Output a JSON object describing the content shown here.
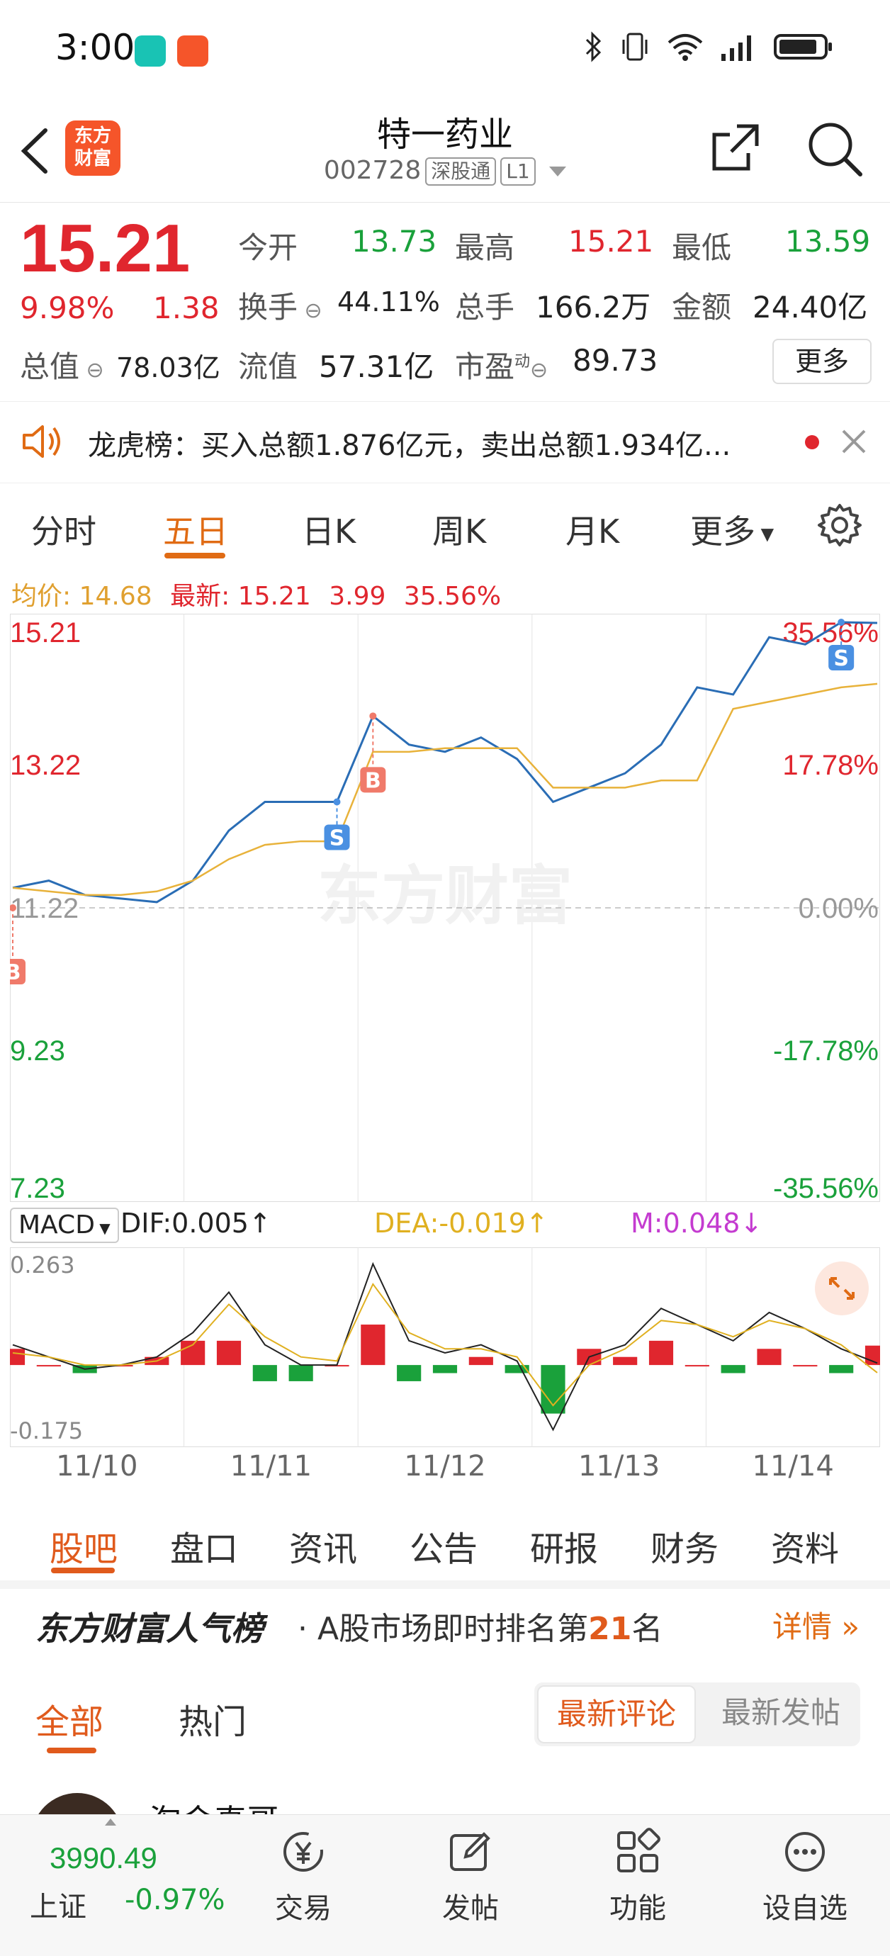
{
  "status_bar": {
    "time": "3:00"
  },
  "header": {
    "title": "特一药业",
    "code": "002728",
    "tag1": "深股通",
    "tag2": "L1",
    "logo_line1": "东方",
    "logo_line2": "财富"
  },
  "quote": {
    "price": "15.21",
    "change_pct": "9.98%",
    "change": "1.38",
    "open_label": "今开",
    "open": "13.73",
    "high_label": "最高",
    "high": "15.21",
    "low_label": "最低",
    "low": "13.59",
    "turnover_label": "换手",
    "turnover": "44.11%",
    "volume_label": "总手",
    "volume": "166.2万",
    "amount_label": "金额",
    "amount": "24.40亿",
    "mktcap_label": "总值",
    "mktcap": "78.03亿",
    "float_label": "流值",
    "float": "57.31亿",
    "pe_label": "市盈",
    "pe_sup": "动",
    "pe": "89.73",
    "more": "更多"
  },
  "notice": {
    "text": "龙虎榜：买入总额1.876亿元，卖出总额1.934亿..."
  },
  "chart_tabs": [
    "分时",
    "五日",
    "日K",
    "周K",
    "月K",
    "更多"
  ],
  "legend": {
    "avg_label": "均价:",
    "avg": "14.68",
    "latest_label": "最新:",
    "latest": "15.21",
    "chg": "3.99",
    "chg_pct": "35.56%"
  },
  "chart_data": {
    "type": "line",
    "x": [
      "11/10",
      "11/11",
      "11/12",
      "11/13",
      "11/14"
    ],
    "y_ticks": [
      "15.21",
      "13.22",
      "11.22",
      "9.23",
      "7.23"
    ],
    "y_ticks_pct": [
      "35.56%",
      "17.78%",
      "0.00%",
      "-17.78%",
      "-35.56%"
    ],
    "ylim": [
      7.23,
      15.21
    ],
    "base": 11.22,
    "series": [
      {
        "values": [
          11.5,
          11.6,
          11.4,
          11.35,
          11.3,
          11.6,
          12.3,
          12.7,
          12.7,
          12.7,
          13.9,
          13.5,
          13.4,
          13.6,
          13.3,
          12.7,
          12.9,
          13.1,
          13.5,
          14.3,
          14.2,
          15.0,
          14.9,
          15.21,
          15.2
        ]
      },
      {
        "values": [
          11.5,
          11.45,
          11.4,
          11.4,
          11.45,
          11.6,
          11.9,
          12.1,
          12.15,
          12.15,
          13.4,
          13.4,
          13.45,
          13.45,
          13.45,
          12.9,
          12.9,
          12.9,
          13.0,
          13.0,
          14.0,
          14.1,
          14.2,
          14.3,
          14.35
        ]
      }
    ],
    "markers": [
      {
        "label": "B",
        "x_index": 0,
        "value": 11.22
      },
      {
        "label": "S",
        "x_index": 9,
        "value": 12.7
      },
      {
        "label": "B",
        "x_index": 10,
        "value": 13.9
      },
      {
        "label": "S",
        "x_index": 23,
        "value": 15.21
      }
    ],
    "watermark": "东方财富",
    "macd": {
      "indicator": "MACD",
      "dif_label": "DIF:0.005↑",
      "dea_label": "DEA:-0.019↑",
      "m_label": "M:0.048↓",
      "ymax": "0.263",
      "ymin": "-0.175",
      "dif": [
        0.05,
        0.02,
        -0.01,
        0.0,
        0.02,
        0.08,
        0.18,
        0.05,
        0.0,
        0.0,
        0.25,
        0.06,
        0.03,
        0.05,
        0.01,
        -0.16,
        0.02,
        0.05,
        0.14,
        0.1,
        0.06,
        0.13,
        0.09,
        0.04,
        0.005
      ],
      "dea": [
        0.03,
        0.02,
        0.0,
        0.0,
        0.01,
        0.05,
        0.15,
        0.07,
        0.02,
        0.01,
        0.2,
        0.08,
        0.04,
        0.04,
        0.02,
        -0.1,
        0.0,
        0.04,
        0.11,
        0.1,
        0.07,
        0.11,
        0.09,
        0.05,
        -0.019
      ],
      "hist": [
        0.04,
        0.0,
        -0.02,
        0.0,
        0.02,
        0.06,
        0.06,
        -0.04,
        -0.04,
        0.0,
        0.1,
        -0.04,
        -0.02,
        0.02,
        -0.02,
        -0.12,
        0.04,
        0.02,
        0.06,
        0.0,
        -0.02,
        0.04,
        0.0,
        -0.02,
        0.048
      ]
    }
  },
  "bottom_tabs": [
    "股吧",
    "盘口",
    "资讯",
    "公告",
    "研报",
    "财务",
    "资料"
  ],
  "ranking": {
    "title": "东方财富人气榜",
    "text_prefix": "· A股市场即时排名第",
    "rank": "21",
    "text_suffix": "名",
    "detail": "详情"
  },
  "feed": {
    "tab_all": "全部",
    "tab_hot": "热门",
    "sort_latest_comment": "最新评论",
    "sort_latest_post": "最新发帖",
    "user_name": "淘金真哥"
  },
  "bottom_nav": {
    "index_value": "3990.49",
    "index_name": "上证",
    "index_change": "-0.97%",
    "items": [
      "交易",
      "发帖",
      "功能",
      "设自选"
    ]
  },
  "colors": {
    "up": "#e0262e",
    "down": "#1aa13b",
    "accent": "#e05a1c",
    "price_line": "#2a6db5",
    "avg_line": "#e8b23a"
  }
}
